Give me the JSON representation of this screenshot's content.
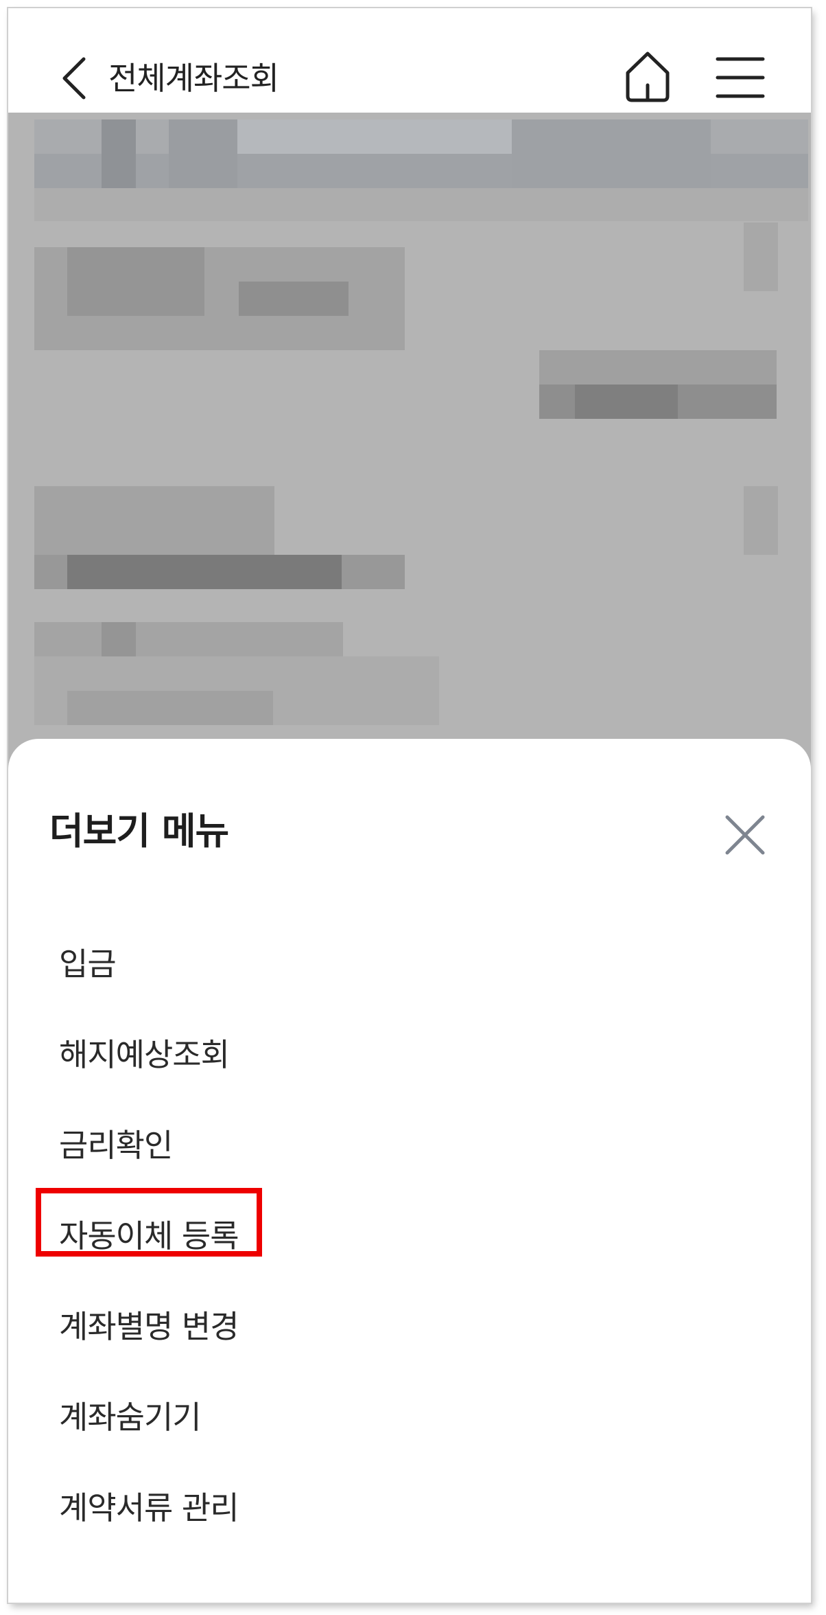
{
  "header": {
    "title": "전체계좌조회",
    "back_icon": "chevron-left-icon",
    "home_icon": "home-icon",
    "menu_icon": "hamburger-menu-icon"
  },
  "sheet": {
    "title": "더보기 메뉴",
    "close_icon": "close-icon",
    "items": [
      {
        "label": "입금"
      },
      {
        "label": "해지예상조회"
      },
      {
        "label": "금리확인"
      },
      {
        "label": "자동이체 등록"
      },
      {
        "label": "계좌별명 변경"
      },
      {
        "label": "계좌숨기기"
      },
      {
        "label": "계약서류 관리"
      }
    ]
  },
  "colors": {
    "dim_background": "#b4b4b4",
    "highlight": "#ee0000",
    "text": "#2a2a2a"
  }
}
